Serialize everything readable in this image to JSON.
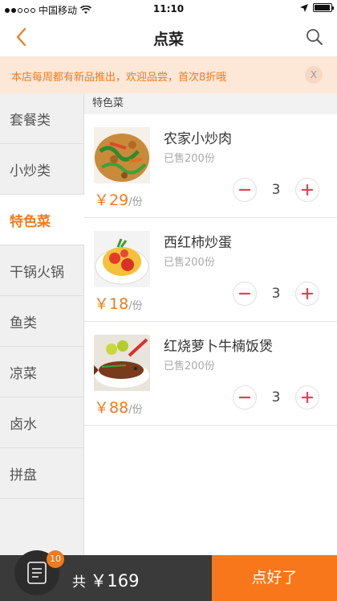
{
  "status_bar": {
    "carrier": "中国移动",
    "time": "11:10",
    "signal_icon": "signal-dots-icon",
    "wifi_icon": "wifi-icon",
    "location_icon": "location-arrow-icon",
    "battery_icon": "battery-icon",
    "battery_level": 0.95
  },
  "nav": {
    "title": "点菜",
    "back_icon": "chevron-left-icon",
    "search_icon": "search-icon"
  },
  "notice": {
    "text": "本店每周都有新品推出，欢迎品尝，首次8折哦",
    "close_label": "X"
  },
  "sidebar": {
    "items": [
      {
        "label": "套餐类",
        "active": false
      },
      {
        "label": "小炒类",
        "active": false
      },
      {
        "label": "特色菜",
        "active": true
      },
      {
        "label": "干锅火锅",
        "active": false
      },
      {
        "label": "鱼类",
        "active": false
      },
      {
        "label": "凉菜",
        "active": false
      },
      {
        "label": "卤水",
        "active": false
      },
      {
        "label": "拼盘",
        "active": false
      }
    ]
  },
  "main": {
    "section_title": "特色菜",
    "dishes": [
      {
        "name": "农家小炒肉",
        "sold": "已售200份",
        "price": "￥29",
        "unit": "/份",
        "qty": "3",
        "image_icon": "stir-fried-pork-photo"
      },
      {
        "name": "西红柿炒蛋",
        "sold": "已售200份",
        "price": "￥18",
        "unit": "/份",
        "qty": "3",
        "image_icon": "tomato-egg-photo"
      },
      {
        "name": "红烧萝卜牛楠饭煲",
        "sold": "已售200份",
        "price": "￥88",
        "unit": "/份",
        "qty": "3",
        "image_icon": "braised-fish-photo"
      }
    ]
  },
  "bottom_bar": {
    "cart_icon": "order-list-icon",
    "cart_count": "10",
    "total_label": "共",
    "total_amount": "￥169",
    "submit_label": "点好了"
  },
  "colors": {
    "accent": "#f07a1e",
    "minus_plus": "#e8405a",
    "notice_bg": "#fde8d8",
    "bottom_bar": "#3a3a3a"
  }
}
